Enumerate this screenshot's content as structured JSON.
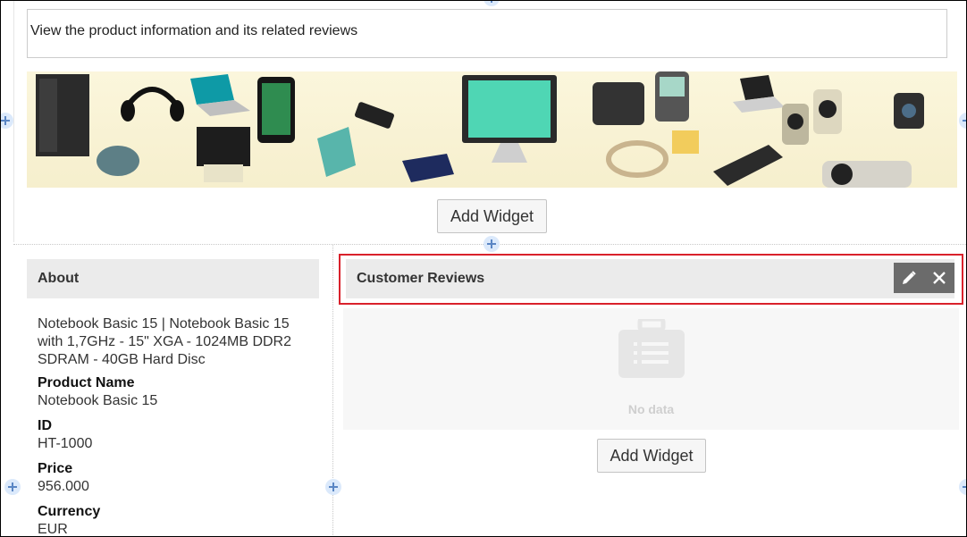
{
  "header": {
    "description": "View the product information and its related reviews"
  },
  "banner": {
    "image_name": "electronics-products-banner"
  },
  "buttons": {
    "add_widget_top": "Add Widget",
    "add_widget_bottom": "Add Widget"
  },
  "about": {
    "title": "About",
    "description": "Notebook Basic 15 | Notebook Basic 15 with 1,7GHz - 15\" XGA - 1024MB DDR2 SDRAM - 40GB Hard Disc",
    "fields": [
      {
        "label": "Product Name",
        "value": "Notebook Basic 15"
      },
      {
        "label": "ID",
        "value": "HT-1000"
      },
      {
        "label": "Price",
        "value": "956.000"
      },
      {
        "label": "Currency",
        "value": "EUR"
      }
    ]
  },
  "reviews": {
    "title": "Customer Reviews",
    "empty_text": "No data",
    "highlight_color": "#d9212b"
  },
  "icons": {
    "edit": "pencil-icon",
    "close": "close-icon",
    "empty": "briefcase-list-icon",
    "plus": "plus-icon"
  }
}
